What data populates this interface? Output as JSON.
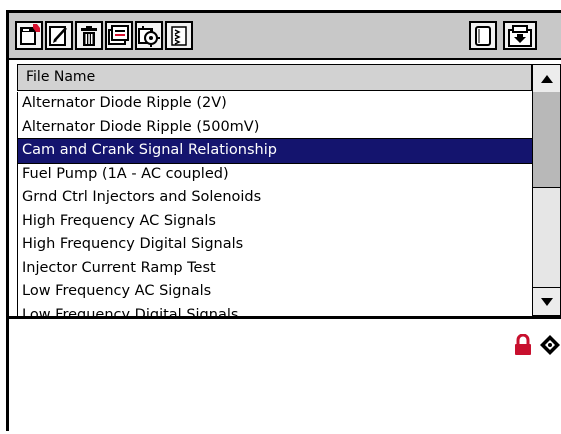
{
  "toolbar": {
    "left_icons": [
      "new-file-icon",
      "edit-icon",
      "delete-icon",
      "print-icon",
      "tools-icon",
      "list-icon"
    ],
    "right_icons": [
      "blank-page-icon",
      "save-icon"
    ]
  },
  "file_list": {
    "column_header": "File Name",
    "rows": [
      "Alternator Diode Ripple (2V)",
      "Alternator Diode Ripple (500mV)",
      "Cam and Crank Signal Relationship",
      "Fuel Pump (1A - AC coupled)",
      "Grnd Ctrl Injectors and Solenoids",
      "High Frequency AC Signals",
      "High Frequency Digital Signals",
      "Injector Current Ramp Test",
      "Low Frequency AC Signals",
      "Low Frequency Digital Signals"
    ],
    "selected_index": 2
  },
  "lower_pane": {
    "icons": [
      "lock-icon",
      "diamond-nav-icon"
    ],
    "lock_color": "#c8102e"
  },
  "colors": {
    "selection": "#14146e",
    "toolbar": "#c8c8c8"
  }
}
